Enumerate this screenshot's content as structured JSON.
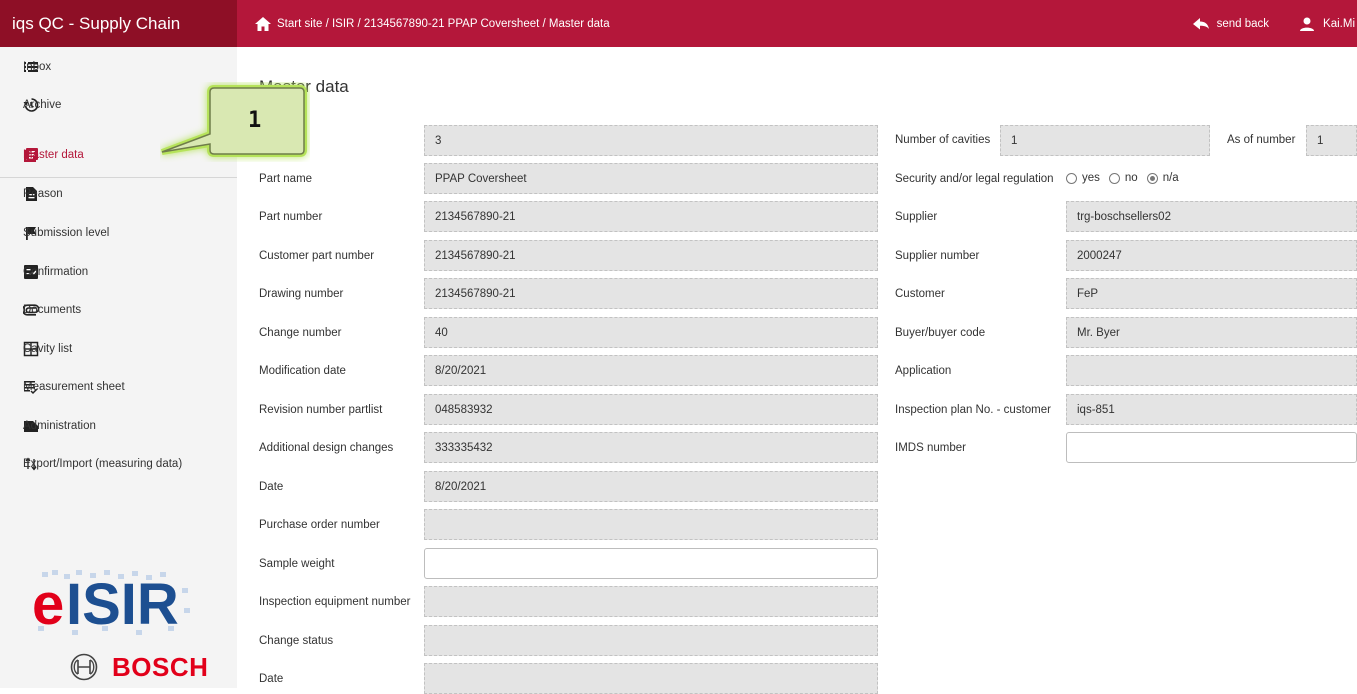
{
  "app": {
    "title": "iqs QC - Supply Chain"
  },
  "breadcrumb": {
    "text": "Start site / ISIR / 2134567890-21 PPAP Coversheet / Master data"
  },
  "header_actions": {
    "send_back": "send back",
    "user": "Kai.Mi"
  },
  "sidebar": {
    "collapse_glyph": "<",
    "items": [
      {
        "label": "Inbox",
        "icon": "list-icon"
      },
      {
        "label": "Archive",
        "icon": "history-icon"
      },
      {
        "label": "Master data",
        "icon": "master-data-icon",
        "active": true
      },
      {
        "label": "Reason",
        "icon": "document-icon"
      },
      {
        "label": "Submission level",
        "icon": "flag-icon"
      },
      {
        "label": "Confirmation",
        "icon": "checklist-icon"
      },
      {
        "label": "Documents",
        "icon": "paperclip-icon"
      },
      {
        "label": "Cavity list",
        "icon": "grid-icon"
      },
      {
        "label": "Measurement sheet",
        "icon": "measurement-icon"
      },
      {
        "label": "Administration",
        "icon": "folder-icon"
      },
      {
        "label": "Export/Import (measuring data)",
        "icon": "import-export-icon"
      }
    ]
  },
  "logos": {
    "eisir": "eISIR",
    "bosch": "BOSCH"
  },
  "main": {
    "title": "Master data",
    "left_fields": [
      {
        "label": "",
        "value": "3"
      },
      {
        "label": "Part name",
        "value": "PPAP Coversheet"
      },
      {
        "label": "Part number",
        "value": "2134567890-21"
      },
      {
        "label": "Customer part number",
        "value": "2134567890-21"
      },
      {
        "label": "Drawing number",
        "value": "2134567890-21"
      },
      {
        "label": "Change number",
        "value": "40"
      },
      {
        "label": "Modification date",
        "value": "8/20/2021"
      },
      {
        "label": "Revision number partlist",
        "value": "048583932"
      },
      {
        "label": "Additional design changes",
        "value": "333335432"
      },
      {
        "label": "Date",
        "value": "8/20/2021"
      },
      {
        "label": "Purchase order number",
        "value": ""
      },
      {
        "label": "Sample weight",
        "value": ""
      },
      {
        "label": "Inspection equipment number",
        "value": ""
      },
      {
        "label": "Change status",
        "value": ""
      },
      {
        "label": "Date",
        "value": ""
      }
    ],
    "cavities": {
      "label": "Number of cavities",
      "value": "1",
      "as_of_label": "As of number",
      "as_of_value": "1"
    },
    "security": {
      "label": "Security and/or legal regulation",
      "options": [
        "yes",
        "no",
        "n/a"
      ],
      "selected": "n/a"
    },
    "right_fields": [
      {
        "label": "Supplier",
        "value": "trg-boschsellers02"
      },
      {
        "label": "Supplier number",
        "value": "2000247"
      },
      {
        "label": "Customer",
        "value": "FeP"
      },
      {
        "label": "Buyer/buyer code",
        "value": "Mr. Byer"
      },
      {
        "label": "Application",
        "value": ""
      },
      {
        "label": "Inspection plan No. - customer",
        "value": "iqs-851"
      },
      {
        "label": "IMDS number",
        "value": ""
      }
    ]
  },
  "callout": {
    "number": "1"
  },
  "colors": {
    "brand_dark": "#8e0f26",
    "brand": "#b4173a",
    "bosch_red": "#e2001a",
    "eisir_blue": "#1d4f91",
    "highlight": "#b6e35a"
  }
}
